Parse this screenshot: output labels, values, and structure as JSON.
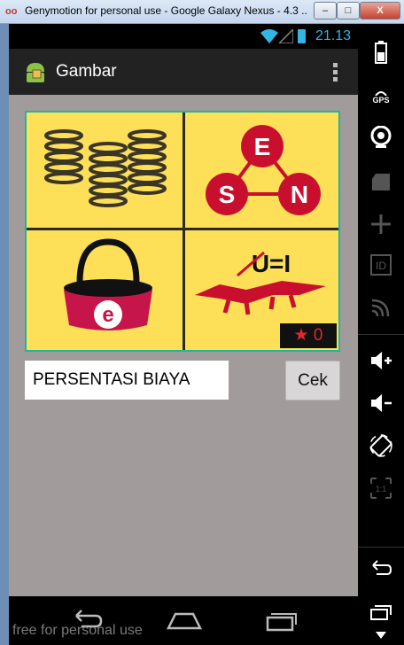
{
  "window": {
    "title": "Genymotion for personal use - Google Galaxy Nexus - 4.3 ...",
    "min_label": "–",
    "max_label": "□",
    "close_label": "X"
  },
  "status": {
    "time": "21.13"
  },
  "actionbar": {
    "title": "Gambar"
  },
  "puzzle": {
    "letters_triangle": [
      "E",
      "S",
      "N"
    ],
    "bag_letter": "e",
    "croc_text": "U=I",
    "stars": "0"
  },
  "answer": {
    "value": "PERSENTASI BIAYA",
    "button_label": "Cek"
  },
  "watermark": "free for personal use",
  "sidebar": {
    "gps_label": "GPS",
    "id_label": "ID",
    "ratio_label": "1:1"
  },
  "colors": {
    "accent": "#33b5e5",
    "puzzle_bg": "#fddf58",
    "puzzle_red": "#c8102e",
    "content_bg": "#a29b9c"
  }
}
